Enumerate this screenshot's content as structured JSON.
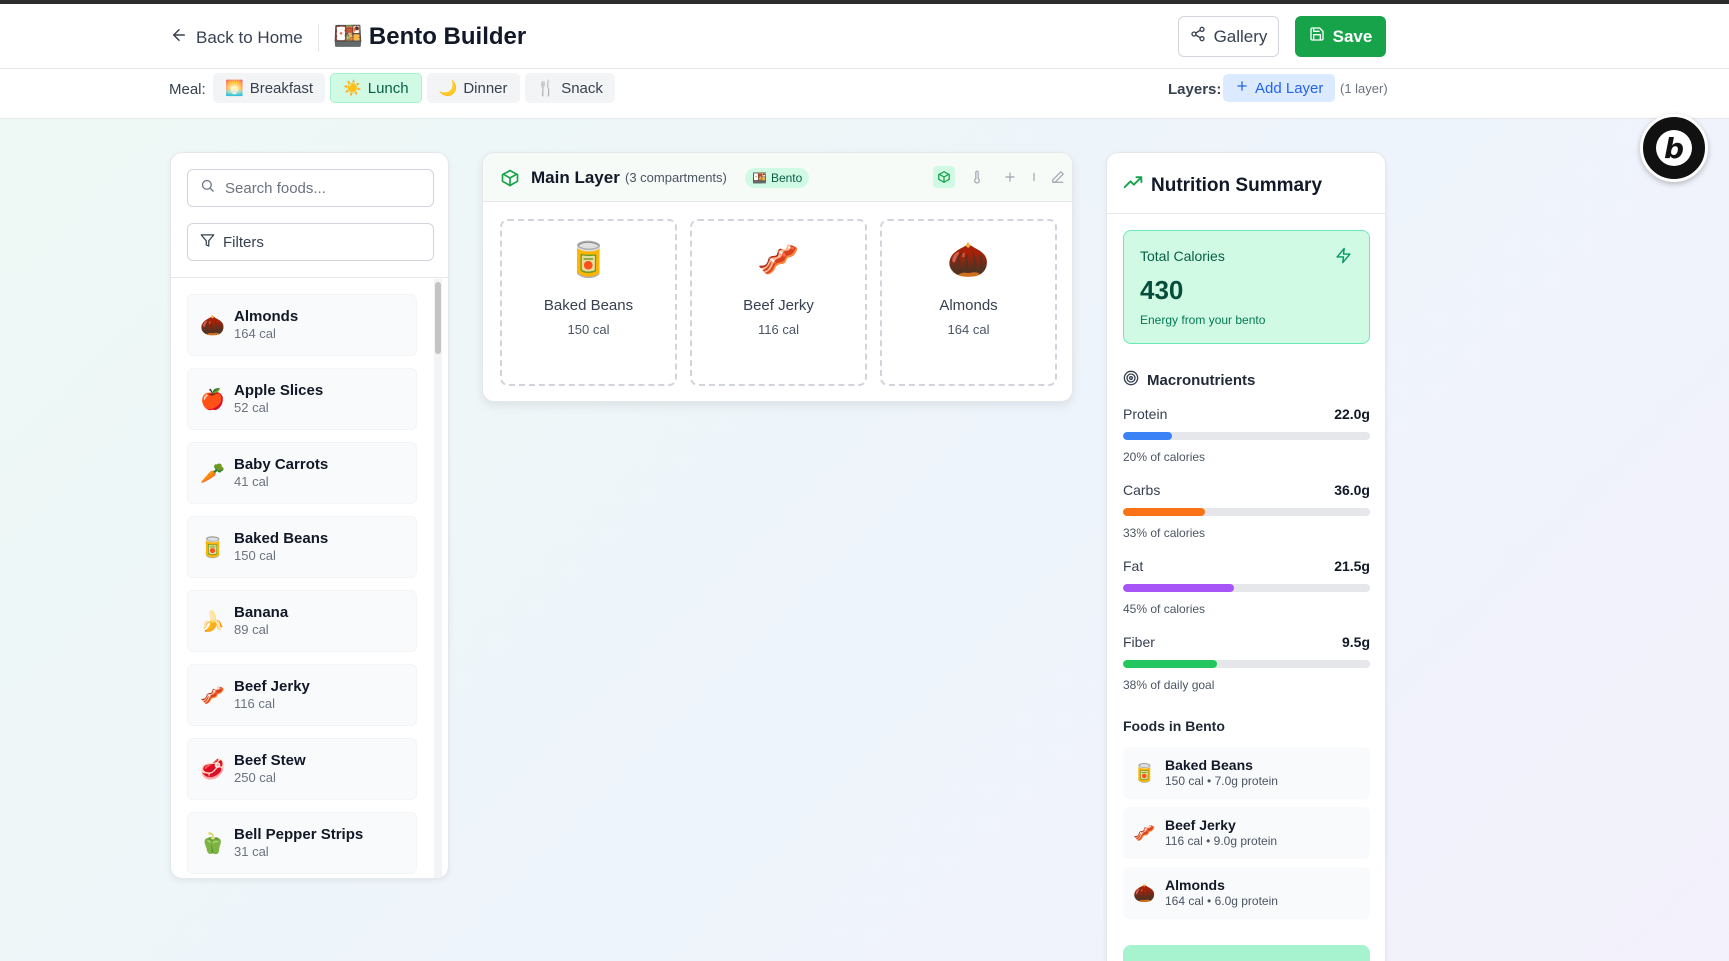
{
  "header": {
    "back_label": "Back to Home",
    "title_emoji": "🍱",
    "title": "Bento Builder",
    "gallery_label": "Gallery",
    "save_label": "Save"
  },
  "subbar": {
    "meal_label": "Meal:",
    "meals": [
      {
        "emoji": "🌅",
        "label": "Breakfast",
        "active": false
      },
      {
        "emoji": "☀️",
        "label": "Lunch",
        "active": true
      },
      {
        "emoji": "🌙",
        "label": "Dinner",
        "active": false
      },
      {
        "emoji": "🍴",
        "label": "Snack",
        "active": false
      }
    ],
    "layers_label": "Layers:",
    "add_layer_label": "Add Layer",
    "layer_count": "(1 layer)"
  },
  "food_panel": {
    "search_placeholder": "Search foods...",
    "filters_label": "Filters",
    "items": [
      {
        "emoji": "🌰",
        "name": "Almonds",
        "cal": "164 cal"
      },
      {
        "emoji": "🍎",
        "name": "Apple Slices",
        "cal": "52 cal"
      },
      {
        "emoji": "🥕",
        "name": "Baby Carrots",
        "cal": "41 cal"
      },
      {
        "emoji": "🥫",
        "name": "Baked Beans",
        "cal": "150 cal"
      },
      {
        "emoji": "🍌",
        "name": "Banana",
        "cal": "89 cal"
      },
      {
        "emoji": "🥓",
        "name": "Beef Jerky",
        "cal": "116 cal"
      },
      {
        "emoji": "🥩",
        "name": "Beef Stew",
        "cal": "250 cal"
      },
      {
        "emoji": "🫑",
        "name": "Bell Pepper Strips",
        "cal": "31 cal"
      }
    ]
  },
  "layer": {
    "title": "Main Layer",
    "subtitle": "(3 compartments)",
    "badge_emoji": "🍱",
    "badge_label": "Bento",
    "compartments": [
      {
        "emoji": "🥫",
        "name": "Baked Beans",
        "cal": "150 cal"
      },
      {
        "emoji": "🥓",
        "name": "Beef Jerky",
        "cal": "116 cal"
      },
      {
        "emoji": "🌰",
        "name": "Almonds",
        "cal": "164 cal"
      }
    ]
  },
  "nutrition": {
    "title": "Nutrition Summary",
    "total_label": "Total Calories",
    "total_value": "430",
    "total_sub": "Energy from your bento",
    "macros_label": "Macronutrients",
    "macros": [
      {
        "name": "Protein",
        "value": "22.0g",
        "note": "20% of calories",
        "fraction": 0.2,
        "color": "#3b82f6"
      },
      {
        "name": "Carbs",
        "value": "36.0g",
        "note": "33% of calories",
        "fraction": 0.33,
        "color": "#f97316"
      },
      {
        "name": "Fat",
        "value": "21.5g",
        "note": "45% of calories",
        "fraction": 0.45,
        "color": "#a855f7"
      },
      {
        "name": "Fiber",
        "value": "9.5g",
        "note": "38% of daily goal",
        "fraction": 0.38,
        "color": "#22c55e"
      }
    ],
    "foods_label": "Foods in Bento",
    "foods": [
      {
        "emoji": "🥫",
        "name": "Baked Beans",
        "meta": "150 cal • 7.0g protein"
      },
      {
        "emoji": "🥓",
        "name": "Beef Jerky",
        "meta": "116 cal • 9.0g protein"
      },
      {
        "emoji": "🌰",
        "name": "Almonds",
        "meta": "164 cal • 6.0g protein"
      }
    ]
  },
  "colors": {
    "accent": "#16a34a",
    "accent_light": "#d1fae5",
    "blue_accent": "#2563eb"
  }
}
